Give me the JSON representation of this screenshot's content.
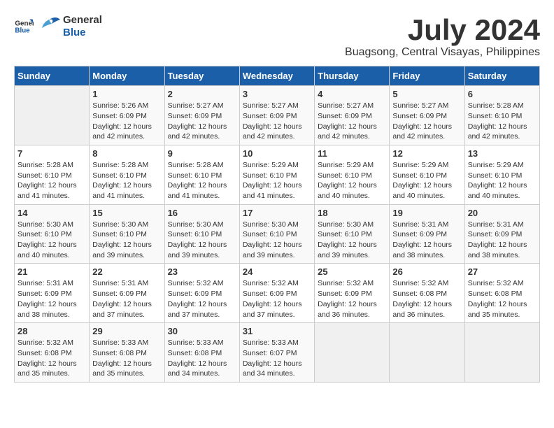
{
  "header": {
    "logo": {
      "general": "General",
      "blue": "Blue"
    },
    "title": "July 2024",
    "location": "Buagsong, Central Visayas, Philippines"
  },
  "calendar": {
    "days_of_week": [
      "Sunday",
      "Monday",
      "Tuesday",
      "Wednesday",
      "Thursday",
      "Friday",
      "Saturday"
    ],
    "weeks": [
      [
        {
          "day": "",
          "info": ""
        },
        {
          "day": "1",
          "info": "Sunrise: 5:26 AM\nSunset: 6:09 PM\nDaylight: 12 hours\nand 42 minutes."
        },
        {
          "day": "2",
          "info": "Sunrise: 5:27 AM\nSunset: 6:09 PM\nDaylight: 12 hours\nand 42 minutes."
        },
        {
          "day": "3",
          "info": "Sunrise: 5:27 AM\nSunset: 6:09 PM\nDaylight: 12 hours\nand 42 minutes."
        },
        {
          "day": "4",
          "info": "Sunrise: 5:27 AM\nSunset: 6:09 PM\nDaylight: 12 hours\nand 42 minutes."
        },
        {
          "day": "5",
          "info": "Sunrise: 5:27 AM\nSunset: 6:09 PM\nDaylight: 12 hours\nand 42 minutes."
        },
        {
          "day": "6",
          "info": "Sunrise: 5:28 AM\nSunset: 6:10 PM\nDaylight: 12 hours\nand 42 minutes."
        }
      ],
      [
        {
          "day": "7",
          "info": "Sunrise: 5:28 AM\nSunset: 6:10 PM\nDaylight: 12 hours\nand 41 minutes."
        },
        {
          "day": "8",
          "info": "Sunrise: 5:28 AM\nSunset: 6:10 PM\nDaylight: 12 hours\nand 41 minutes."
        },
        {
          "day": "9",
          "info": "Sunrise: 5:28 AM\nSunset: 6:10 PM\nDaylight: 12 hours\nand 41 minutes."
        },
        {
          "day": "10",
          "info": "Sunrise: 5:29 AM\nSunset: 6:10 PM\nDaylight: 12 hours\nand 41 minutes."
        },
        {
          "day": "11",
          "info": "Sunrise: 5:29 AM\nSunset: 6:10 PM\nDaylight: 12 hours\nand 40 minutes."
        },
        {
          "day": "12",
          "info": "Sunrise: 5:29 AM\nSunset: 6:10 PM\nDaylight: 12 hours\nand 40 minutes."
        },
        {
          "day": "13",
          "info": "Sunrise: 5:29 AM\nSunset: 6:10 PM\nDaylight: 12 hours\nand 40 minutes."
        }
      ],
      [
        {
          "day": "14",
          "info": "Sunrise: 5:30 AM\nSunset: 6:10 PM\nDaylight: 12 hours\nand 40 minutes."
        },
        {
          "day": "15",
          "info": "Sunrise: 5:30 AM\nSunset: 6:10 PM\nDaylight: 12 hours\nand 39 minutes."
        },
        {
          "day": "16",
          "info": "Sunrise: 5:30 AM\nSunset: 6:10 PM\nDaylight: 12 hours\nand 39 minutes."
        },
        {
          "day": "17",
          "info": "Sunrise: 5:30 AM\nSunset: 6:10 PM\nDaylight: 12 hours\nand 39 minutes."
        },
        {
          "day": "18",
          "info": "Sunrise: 5:30 AM\nSunset: 6:10 PM\nDaylight: 12 hours\nand 39 minutes."
        },
        {
          "day": "19",
          "info": "Sunrise: 5:31 AM\nSunset: 6:09 PM\nDaylight: 12 hours\nand 38 minutes."
        },
        {
          "day": "20",
          "info": "Sunrise: 5:31 AM\nSunset: 6:09 PM\nDaylight: 12 hours\nand 38 minutes."
        }
      ],
      [
        {
          "day": "21",
          "info": "Sunrise: 5:31 AM\nSunset: 6:09 PM\nDaylight: 12 hours\nand 38 minutes."
        },
        {
          "day": "22",
          "info": "Sunrise: 5:31 AM\nSunset: 6:09 PM\nDaylight: 12 hours\nand 37 minutes."
        },
        {
          "day": "23",
          "info": "Sunrise: 5:32 AM\nSunset: 6:09 PM\nDaylight: 12 hours\nand 37 minutes."
        },
        {
          "day": "24",
          "info": "Sunrise: 5:32 AM\nSunset: 6:09 PM\nDaylight: 12 hours\nand 37 minutes."
        },
        {
          "day": "25",
          "info": "Sunrise: 5:32 AM\nSunset: 6:09 PM\nDaylight: 12 hours\nand 36 minutes."
        },
        {
          "day": "26",
          "info": "Sunrise: 5:32 AM\nSunset: 6:08 PM\nDaylight: 12 hours\nand 36 minutes."
        },
        {
          "day": "27",
          "info": "Sunrise: 5:32 AM\nSunset: 6:08 PM\nDaylight: 12 hours\nand 35 minutes."
        }
      ],
      [
        {
          "day": "28",
          "info": "Sunrise: 5:32 AM\nSunset: 6:08 PM\nDaylight: 12 hours\nand 35 minutes."
        },
        {
          "day": "29",
          "info": "Sunrise: 5:33 AM\nSunset: 6:08 PM\nDaylight: 12 hours\nand 35 minutes."
        },
        {
          "day": "30",
          "info": "Sunrise: 5:33 AM\nSunset: 6:08 PM\nDaylight: 12 hours\nand 34 minutes."
        },
        {
          "day": "31",
          "info": "Sunrise: 5:33 AM\nSunset: 6:07 PM\nDaylight: 12 hours\nand 34 minutes."
        },
        {
          "day": "",
          "info": ""
        },
        {
          "day": "",
          "info": ""
        },
        {
          "day": "",
          "info": ""
        }
      ]
    ]
  }
}
